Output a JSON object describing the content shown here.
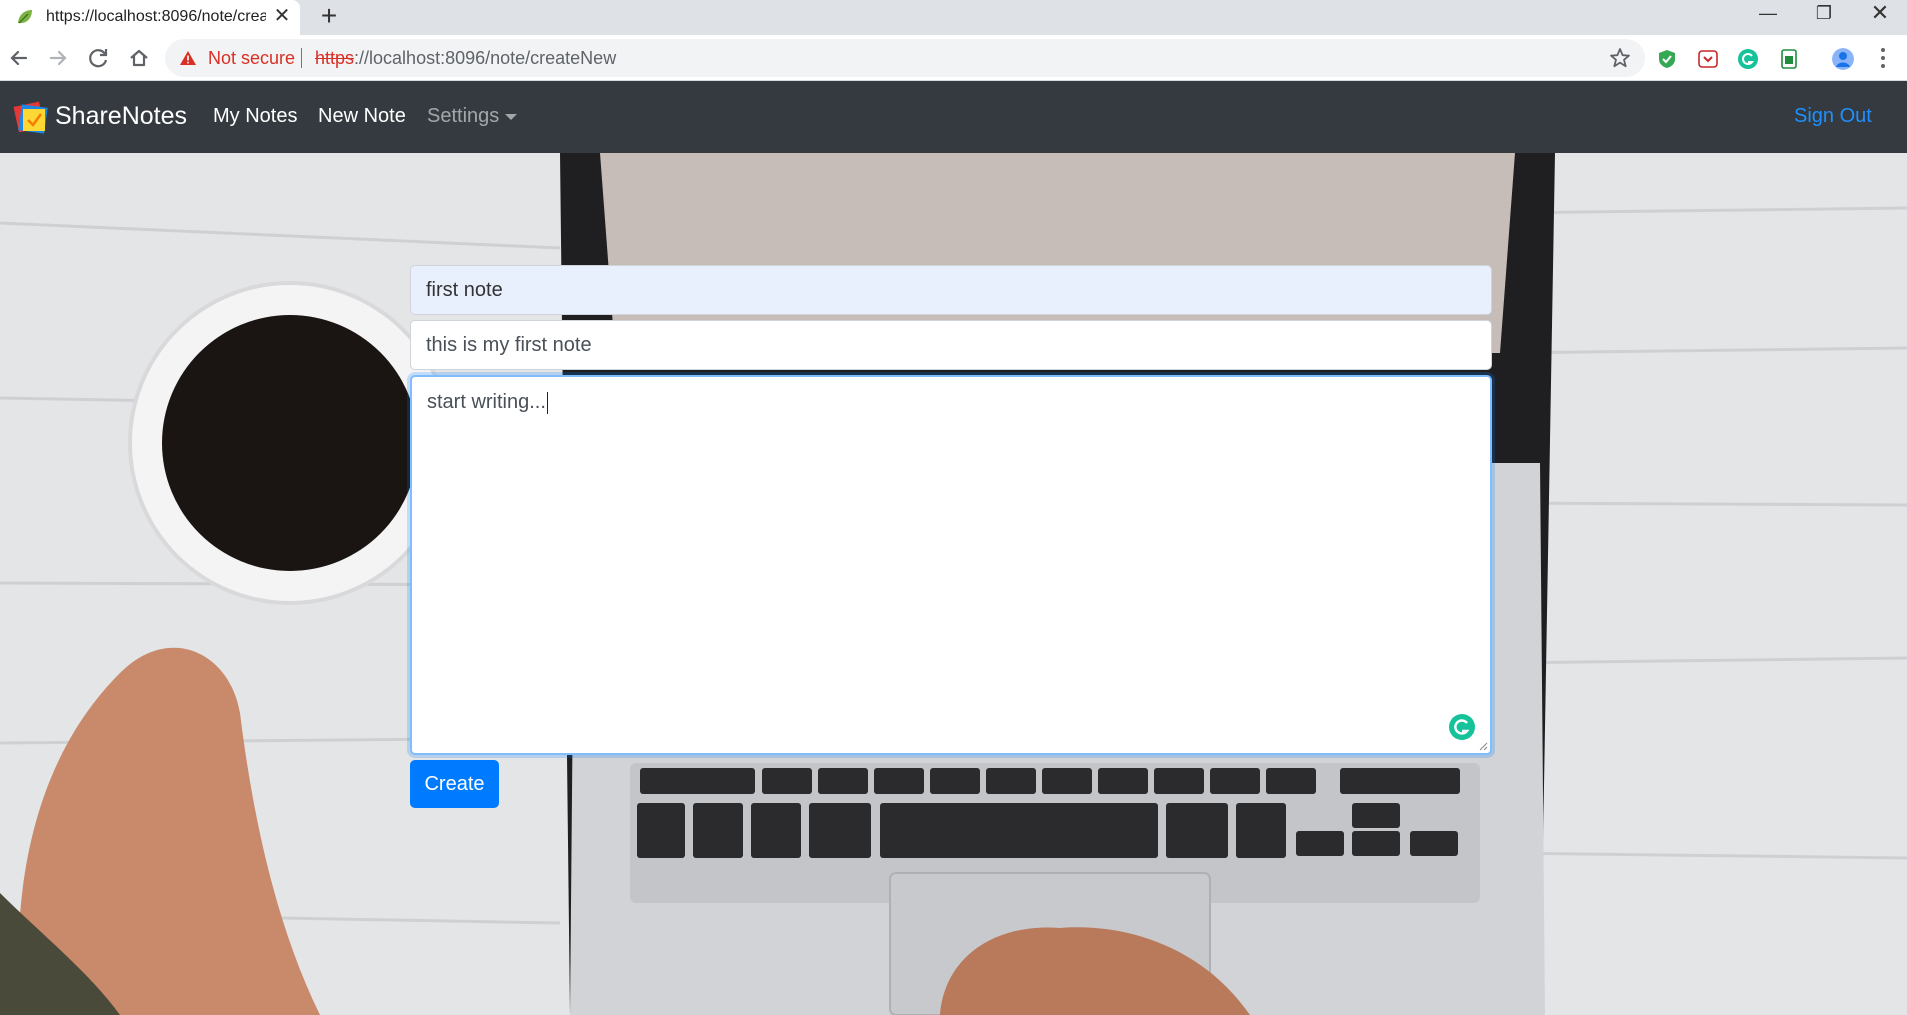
{
  "browser": {
    "tab": {
      "title": "https://localhost:8096/note/createNew",
      "close_symbol": "✕"
    },
    "new_tab_symbol": "+",
    "window_controls": {
      "minimize": "—",
      "maximize": "❐",
      "close": "✕"
    },
    "address_bar": {
      "security_text": "Not secure",
      "url_scheme": "https",
      "url_rest": "://localhost:8096/note/createNew"
    },
    "extensions": [
      "shield-extension-icon",
      "pocket-extension-icon",
      "grammarly-extension-icon",
      "sheets-extension-icon",
      "profile-avatar-icon"
    ]
  },
  "navbar": {
    "brand": "ShareNotes",
    "links": {
      "my_notes": "My Notes",
      "new_note": "New Note",
      "settings": "Settings"
    },
    "sign_out": "Sign Out"
  },
  "form": {
    "title_value": "first note",
    "description_value": "this is my first note",
    "content_value": "start writing...",
    "submit_label": "Create"
  },
  "colors": {
    "navbar_bg": "#343a40",
    "primary": "#007bff",
    "sign_out_link": "#1e90ff",
    "autofill_bg": "#e8f0fe",
    "not_secure_red": "#d93025"
  }
}
